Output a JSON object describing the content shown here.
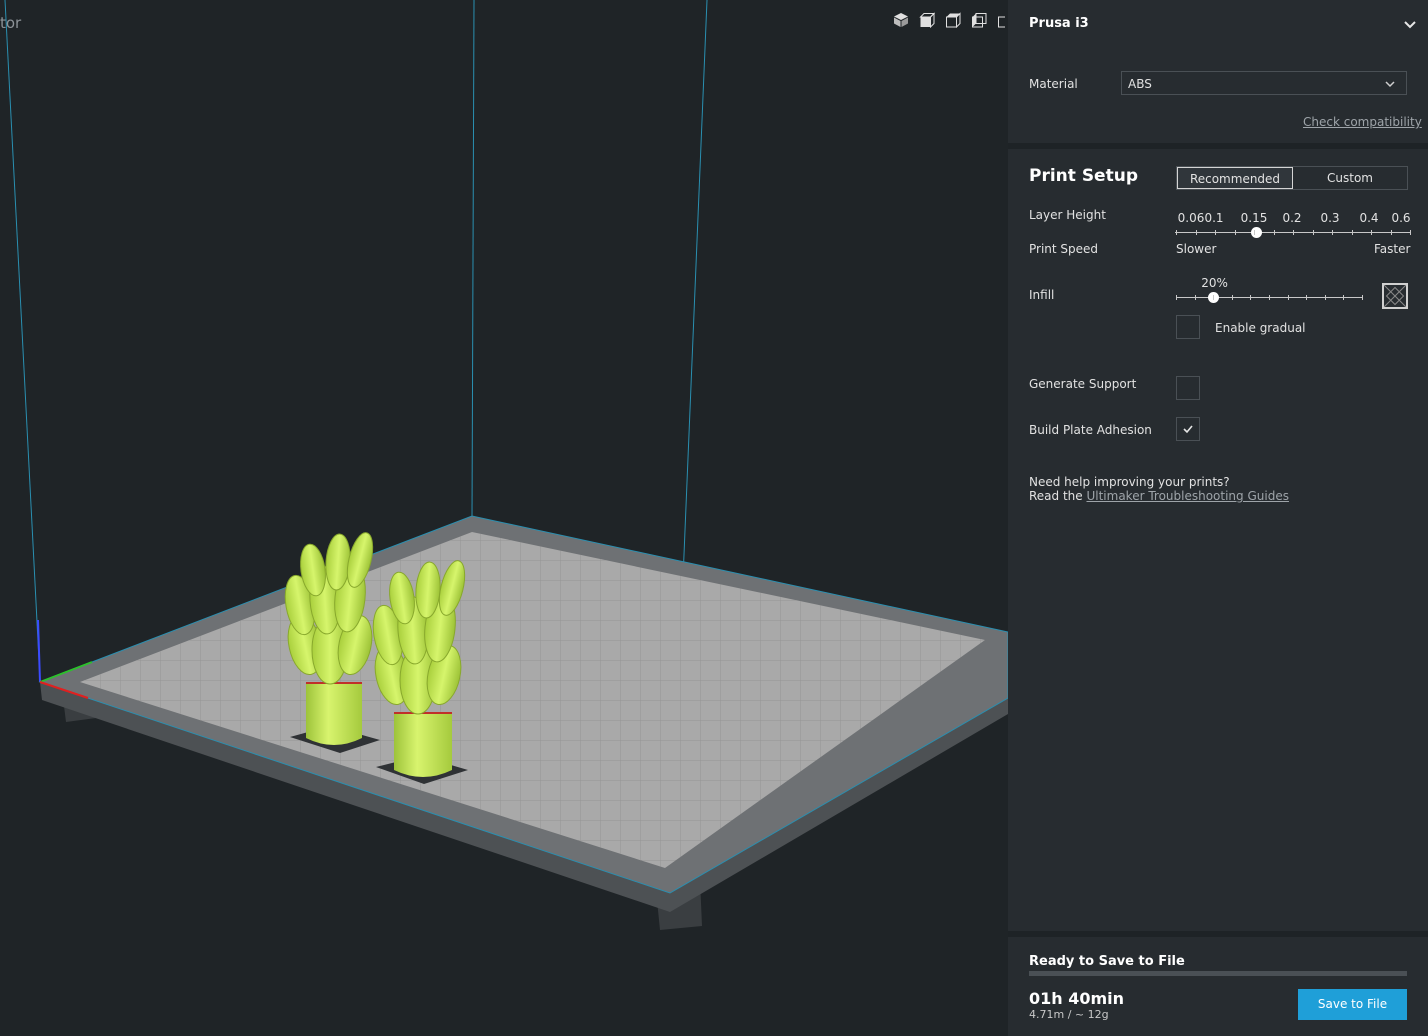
{
  "viewport": {
    "title_fragment": "tor",
    "view_icons": [
      "3d-view-icon",
      "front-view-icon",
      "top-view-icon",
      "left-view-icon",
      "right-view-icon"
    ],
    "model_color": "#c8f05a"
  },
  "machine": {
    "printer_name": "Prusa i3",
    "material_label": "Material",
    "material_value": "ABS",
    "check_compat": "Check compatibility"
  },
  "setup": {
    "title": "Print Setup",
    "mode_recommended": "Recommended",
    "mode_custom": "Custom",
    "mode_selected": "Recommended",
    "layer_height_label": "Layer Height",
    "layer_heights": [
      "0.06",
      "0.1",
      "0.15",
      "0.2",
      "0.3",
      "0.4",
      "0.6"
    ],
    "layer_height_selected": "0.15",
    "print_speed_label": "Print Speed",
    "speed_slower": "Slower",
    "speed_faster": "Faster",
    "infill_label": "Infill",
    "infill_value": "20%",
    "infill_percent": 20,
    "enable_gradual_label": "Enable gradual",
    "enable_gradual_checked": false,
    "support_label": "Generate Support",
    "support_checked": false,
    "adhesion_label": "Build Plate Adhesion",
    "adhesion_checked": true,
    "help_line1": "Need help improving your prints?",
    "help_line2_prefix": "Read the ",
    "help_link": "Ultimaker Troubleshooting Guides"
  },
  "save": {
    "status": "Ready to Save to File",
    "progress": 0,
    "print_time": "01h 40min",
    "material_usage": "4.71m / ~ 12g",
    "save_button": "Save to File",
    "accent": "#1f9fd8"
  }
}
